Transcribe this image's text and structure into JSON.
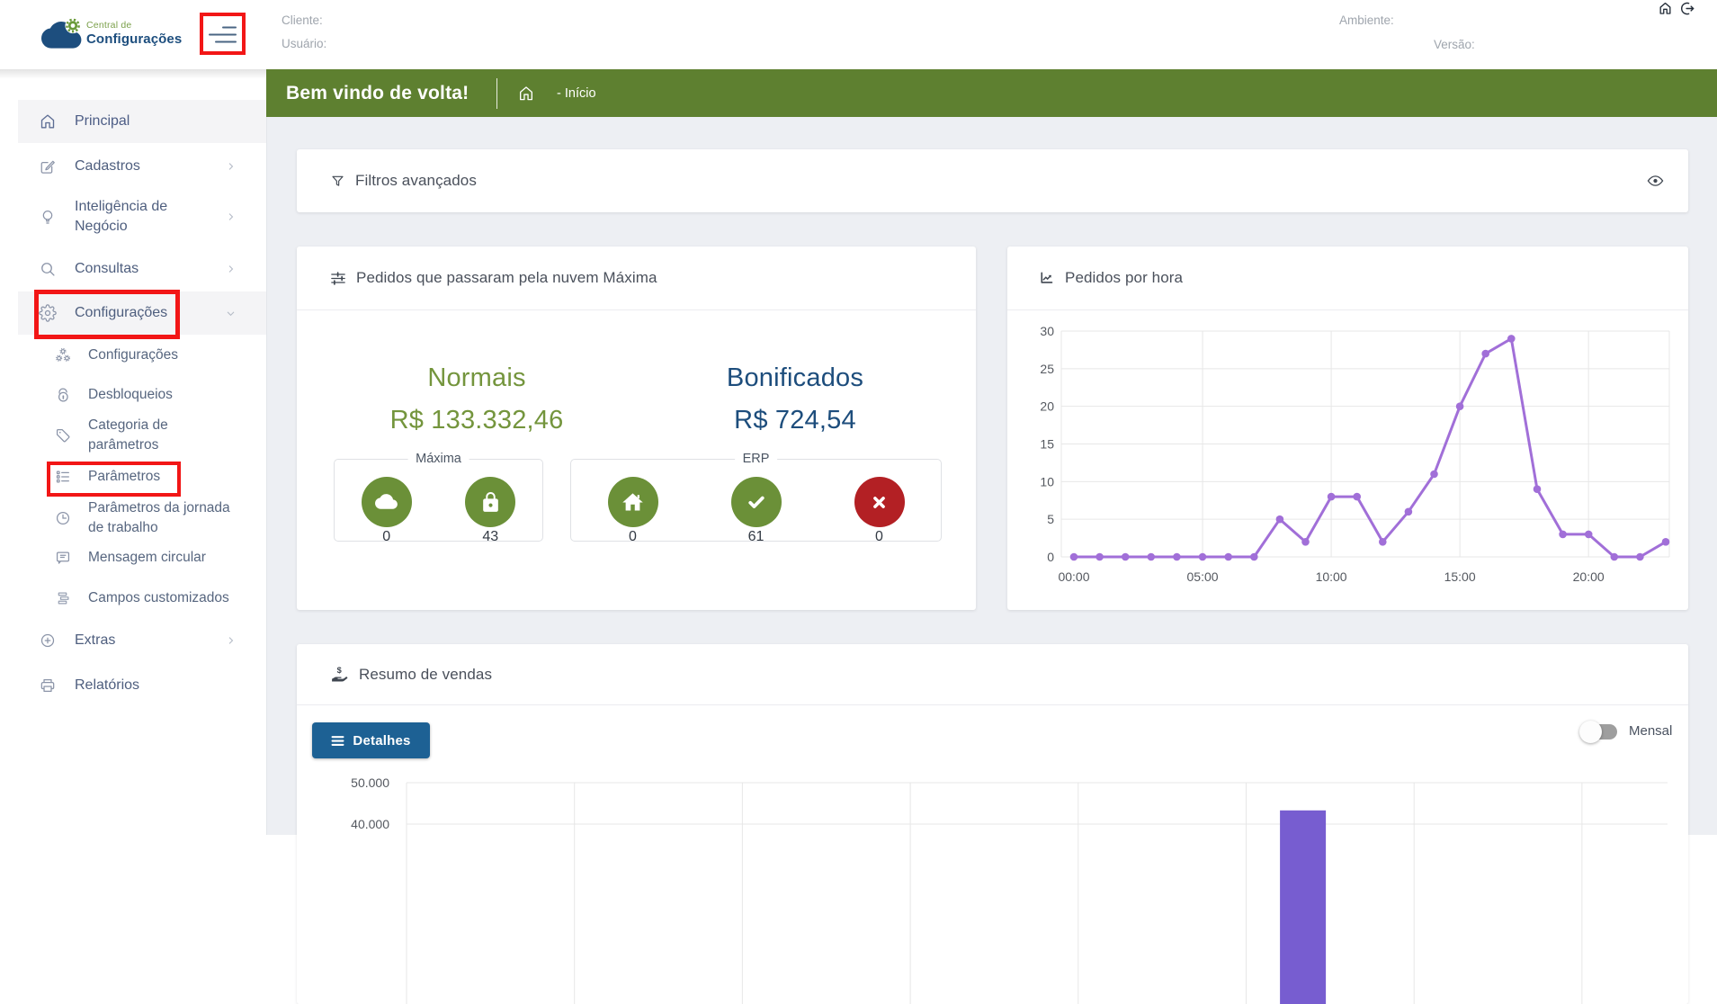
{
  "header": {
    "logo_line1": "Central de",
    "logo_line2": "Configurações",
    "cliente_label": "Cliente:",
    "usuario_label": "Usuário:",
    "ambiente_label": "Ambiente:",
    "versao_label": "Versão:"
  },
  "banner": {
    "title": "Bem vindo de volta!",
    "breadcrumb": "- Início"
  },
  "sidebar": {
    "items": [
      {
        "label": "Principal",
        "icon": "home",
        "active": true
      },
      {
        "label": "Cadastros",
        "icon": "edit",
        "chevron": "right"
      },
      {
        "label": "Inteligência de Negócio",
        "icon": "lightbulb",
        "chevron": "right"
      },
      {
        "label": "Consultas",
        "icon": "search",
        "chevron": "right"
      },
      {
        "label": "Configurações",
        "icon": "gear",
        "chevron": "down",
        "active": true,
        "annotated": true
      },
      {
        "label": "Configurações",
        "icon": "gears",
        "sub": true
      },
      {
        "label": "Desbloqueios",
        "icon": "unlock",
        "sub": true
      },
      {
        "label": "Categoria de parâmetros",
        "icon": "tag",
        "sub": true
      },
      {
        "label": "Parâmetros",
        "icon": "list",
        "sub": true,
        "annotated": true
      },
      {
        "label": "Parâmetros da jornada de trabalho",
        "icon": "clock",
        "sub": true
      },
      {
        "label": "Mensagem circular",
        "icon": "message",
        "sub": true
      },
      {
        "label": "Campos customizados",
        "icon": "layers",
        "sub": true
      },
      {
        "label": "Extras",
        "icon": "plus-circle",
        "chevron": "right"
      },
      {
        "label": "Relatórios",
        "icon": "printer"
      }
    ]
  },
  "filters_card": {
    "title": "Filtros avançados"
  },
  "orders_card": {
    "title": "Pedidos que passaram pela nuvem Máxima",
    "normais_label": "Normais",
    "normais_value": "R$ 133.332,46",
    "bonificados_label": "Bonificados",
    "bonificados_value": "R$ 724,54",
    "maxima_legend": "Máxima",
    "maxima_items": [
      {
        "icon": "cloud",
        "count": "0"
      },
      {
        "icon": "lock",
        "count": "43"
      }
    ],
    "erp_legend": "ERP",
    "erp_items": [
      {
        "icon": "house",
        "count": "0"
      },
      {
        "icon": "check",
        "count": "61"
      },
      {
        "icon": "x-mark",
        "count": "0"
      }
    ]
  },
  "hourly_card": {
    "title": "Pedidos por hora"
  },
  "sales_card": {
    "title": "Resumo de vendas",
    "details_label": "Detalhes",
    "toggle_label": "Mensal",
    "toggle_state": "off"
  },
  "colors": {
    "banner_green": "#5e8030",
    "logo_blue": "#1d4e7e",
    "logo_green": "#6a9a39",
    "normais_green": "#74953d",
    "bonificados_blue": "#1d4d7c",
    "circle_green": "#6b9038",
    "circle_red": "#b32024",
    "button_blue": "#1d6194",
    "line_purple": "#a16fd8",
    "bar_purple": "#775dd0",
    "annotation_red": "#f21616"
  },
  "chart_data": [
    {
      "type": "line",
      "title": "Pedidos por hora",
      "x": [
        "00:00",
        "01:00",
        "02:00",
        "03:00",
        "04:00",
        "05:00",
        "06:00",
        "07:00",
        "08:00",
        "09:00",
        "10:00",
        "11:00",
        "12:00",
        "13:00",
        "14:00",
        "15:00",
        "16:00",
        "17:00",
        "18:00",
        "19:00",
        "20:00",
        "21:00",
        "22:00",
        "23:00"
      ],
      "values": [
        0,
        0,
        0,
        0,
        0,
        0,
        0,
        0,
        5,
        2,
        8,
        8,
        2,
        6,
        11,
        20,
        27,
        29,
        9,
        3,
        3,
        0,
        0,
        2
      ],
      "xticks": [
        "00:00",
        "05:00",
        "10:00",
        "15:00",
        "20:00"
      ],
      "xtick_indexes": [
        0,
        5,
        10,
        15,
        20
      ],
      "yticks": [
        0,
        5,
        10,
        15,
        20,
        25,
        30
      ],
      "ylim": [
        0,
        30
      ],
      "grid": true,
      "legend": "none",
      "line_color": "#a16fd8",
      "marker": "dot"
    },
    {
      "type": "bar",
      "title": "Resumo de vendas",
      "note": "chart cut off at bottom edge of screenshot; only top of plot visible",
      "visible_yticks": [
        "50.000",
        "40.000"
      ],
      "visible_ytick_values": [
        50000,
        40000
      ],
      "visible_bar": {
        "x_index": 16,
        "value": 43300
      },
      "x_slots": 24,
      "grid": true,
      "bar_color": "#775dd0"
    }
  ]
}
